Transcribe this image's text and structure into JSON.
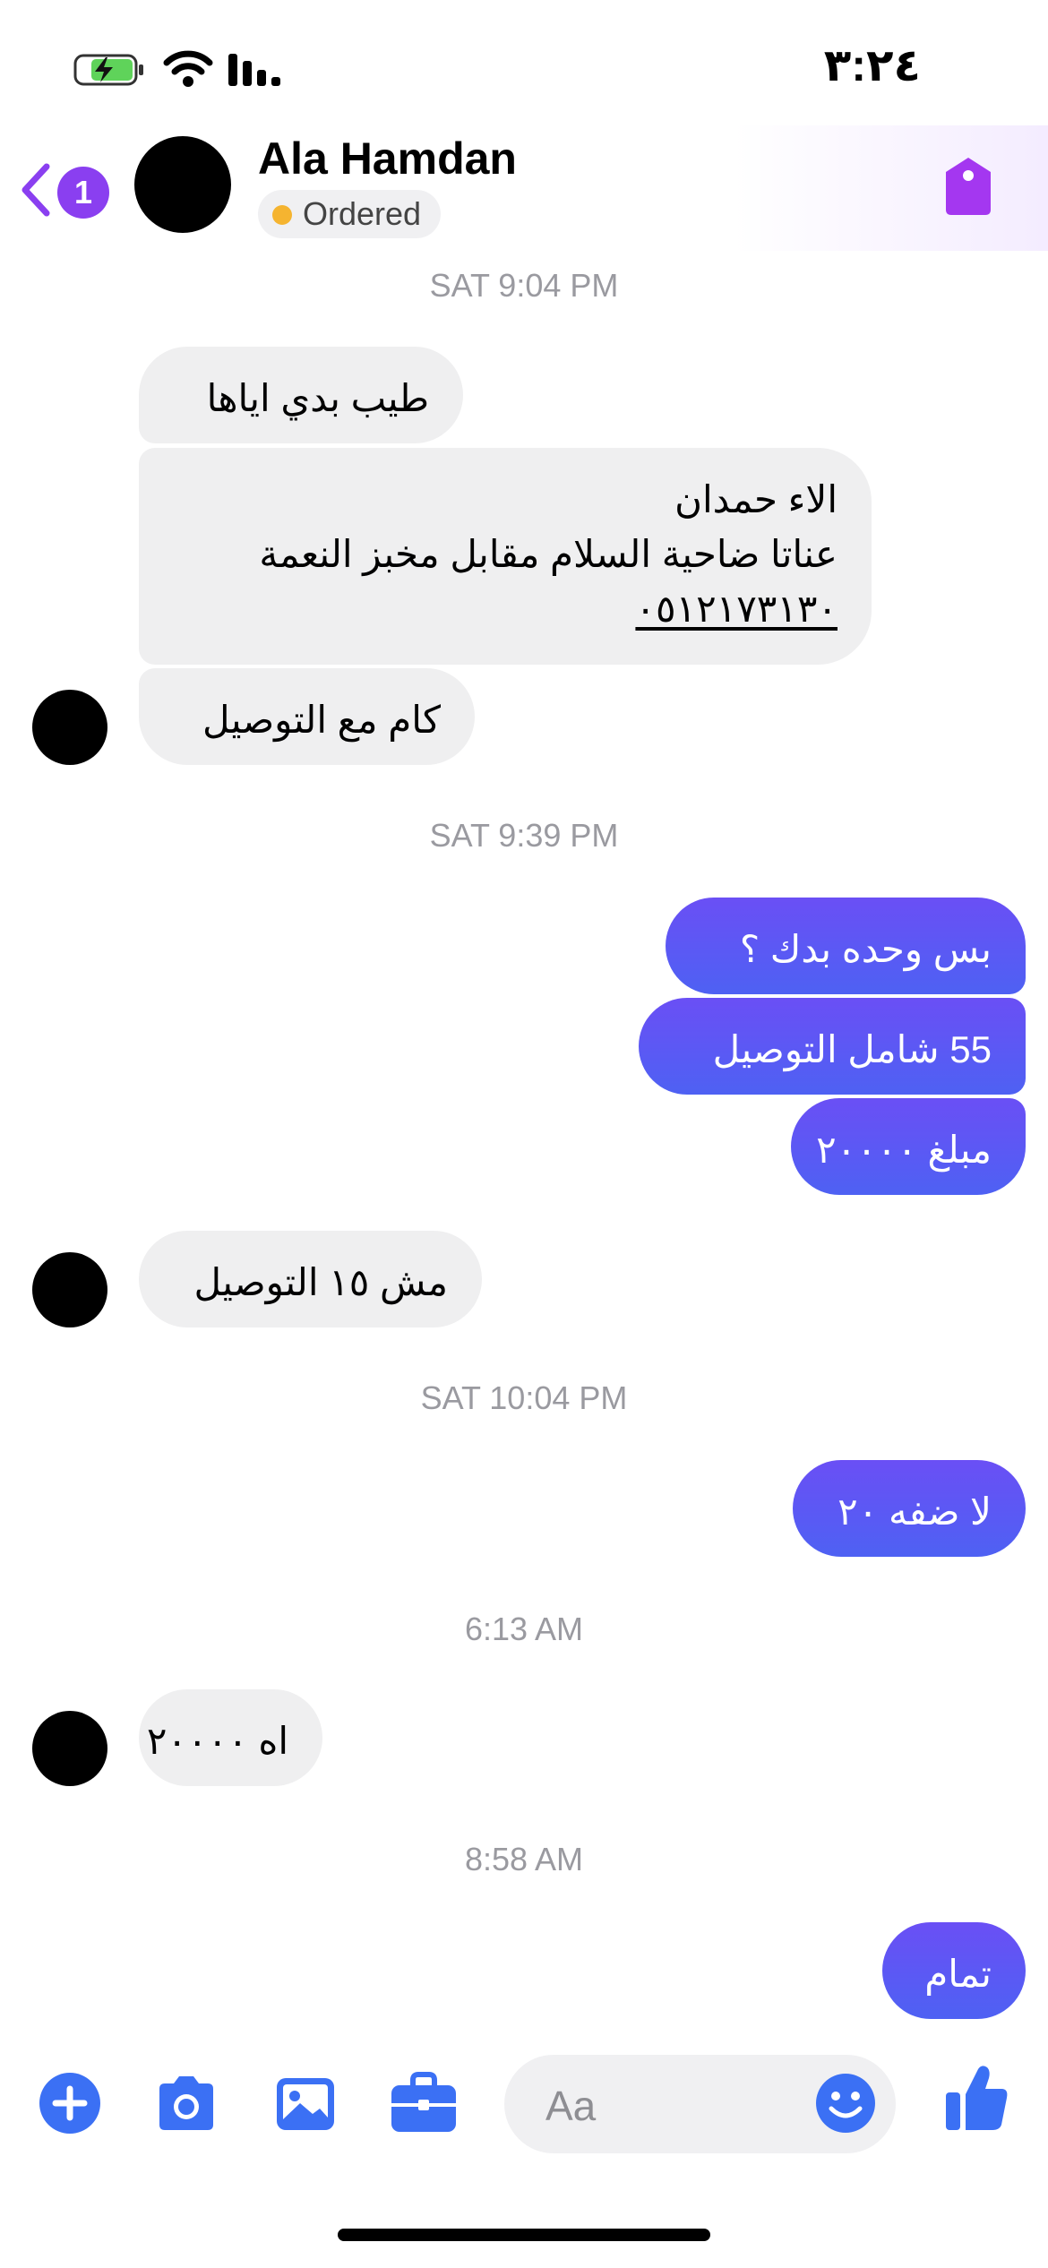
{
  "status_bar": {
    "time": "٣:٢٤"
  },
  "header": {
    "back_badge": "1",
    "contact_name": "Ala Hamdan",
    "status": "Ordered"
  },
  "chat": {
    "timestamps": [
      "SAT 9:04 PM",
      "SAT 9:39 PM",
      "SAT 10:04 PM",
      "6:13 AM",
      "8:58 AM"
    ],
    "messages": [
      {
        "from": "contact",
        "text": "طيب بدي اياها"
      },
      {
        "from": "contact",
        "lines": [
          "الاء حمدان",
          "عناتا ضاحية السلام مقابل مخبز النعمة",
          "٠٥١٢١٧٣١٣٠"
        ]
      },
      {
        "from": "contact",
        "text": "كام مع التوصيل"
      },
      {
        "from": "me",
        "text": "بس وحده بدك ؟"
      },
      {
        "from": "me",
        "text": "55 شامل التوصيل"
      },
      {
        "from": "me",
        "text": "مبلغ ٢٠٠٠٠"
      },
      {
        "from": "contact",
        "text": "مش ١٥ التوصيل"
      },
      {
        "from": "me",
        "text": "لا ضفه ٢٠"
      },
      {
        "from": "contact",
        "text": "اه ٢٠٠٠٠"
      },
      {
        "from": "me",
        "text": "تمام"
      }
    ]
  },
  "composer": {
    "placeholder": "Aa"
  },
  "icons": {
    "battery": "battery-charging-icon",
    "wifi": "wifi-icon",
    "signal": "signal-icon",
    "back": "chevron-left-icon",
    "tag": "tag-icon",
    "plus": "plus-icon",
    "camera": "camera-icon",
    "gallery": "image-icon",
    "business": "briefcase-icon",
    "emoji": "smiley-icon",
    "like": "thumbs-up-icon"
  },
  "colors": {
    "accent": "#4e61f3",
    "purple": "#8a3ff0",
    "status_dot": "#f5b430"
  }
}
